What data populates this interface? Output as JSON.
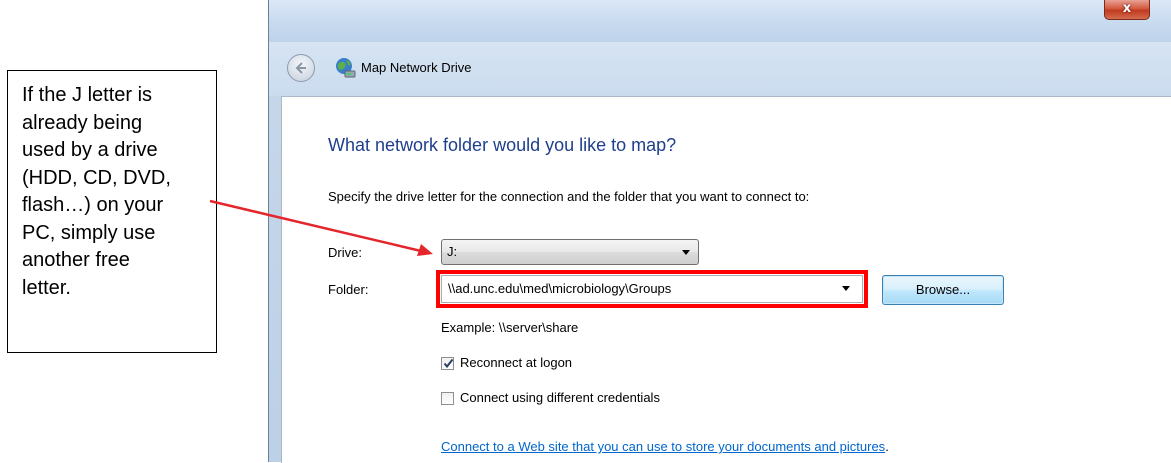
{
  "annotation": {
    "lines": [
      "If the J letter is",
      "already being",
      "used by a drive",
      "(HDD, CD, DVD,",
      "flash…) on your",
      "PC, simply use",
      "another free",
      "letter."
    ],
    "arrow_color": "#e3262b"
  },
  "window": {
    "title": "Map Network Drive",
    "close_label": "x"
  },
  "dialog": {
    "heading": "What network folder would you like to map?",
    "instructions": "Specify the drive letter for the connection and the folder that you want to connect to:",
    "drive_label": "Drive:",
    "drive_value": "J:",
    "folder_label": "Folder:",
    "folder_value": "\\\\ad.unc.edu\\med\\microbiology\\Groups",
    "browse_label": "Browse...",
    "example": "Example: \\\\server\\share",
    "reconnect_label": "Reconnect at logon",
    "reconnect_checked": true,
    "credentials_label": "Connect using different credentials",
    "credentials_checked": false,
    "link_text": "Connect to a Web site that you can use to store your documents and pictures",
    "link_trailing": "."
  },
  "colors": {
    "heading": "#1e3f8c",
    "link": "#0066cc",
    "highlight": "#ff0000"
  }
}
